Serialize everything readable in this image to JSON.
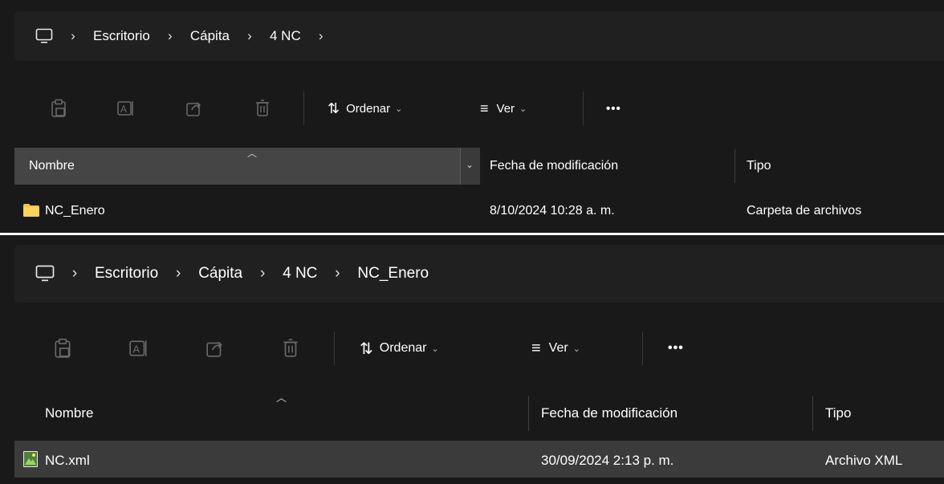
{
  "window1": {
    "breadcrumb": [
      "Escritorio",
      "Cápita",
      "4 NC"
    ],
    "toolbar": {
      "sort_label": "Ordenar",
      "view_label": "Ver",
      "more_label": "•••"
    },
    "columns": {
      "name": "Nombre",
      "modified": "Fecha de modificación",
      "type": "Tipo"
    },
    "rows": [
      {
        "name": "NC_Enero",
        "modified": "8/10/2024 10:28 a. m.",
        "type": "Carpeta de archivos",
        "icon": "folder-icon"
      }
    ]
  },
  "window2": {
    "breadcrumb": [
      "Escritorio",
      "Cápita",
      "4 NC",
      "NC_Enero"
    ],
    "toolbar": {
      "sort_label": "Ordenar",
      "view_label": "Ver",
      "more_label": "•••"
    },
    "columns": {
      "name": "Nombre",
      "modified": "Fecha de modificación",
      "type": "Tipo"
    },
    "rows": [
      {
        "name": "NC.xml",
        "modified": "30/09/2024 2:13 p. m.",
        "type": "Archivo XML",
        "icon": "xml-file-icon"
      }
    ]
  },
  "colors": {
    "background": "#191919",
    "address_bar": "#202020",
    "header_sorted": "#454545",
    "row_selected": "#3b3b3b",
    "folder": "#f8c445",
    "text": "#ffffff"
  }
}
